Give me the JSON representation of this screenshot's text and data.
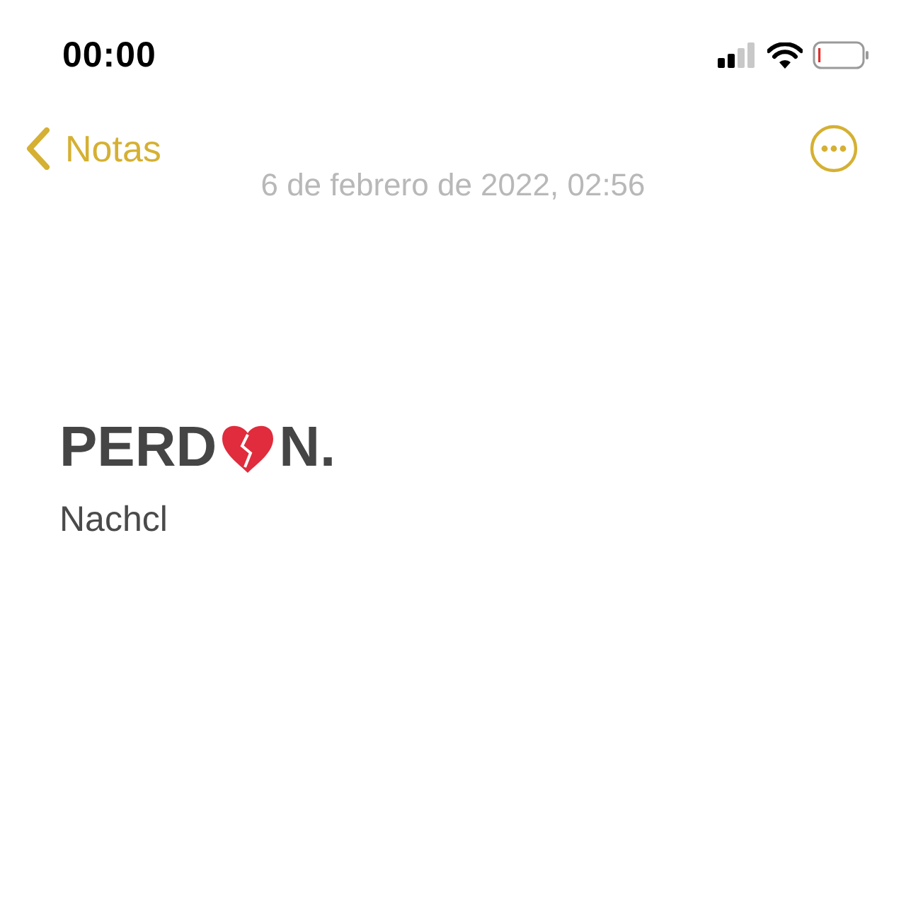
{
  "status_bar": {
    "time": "00:00"
  },
  "nav": {
    "back_label": "Notas"
  },
  "note": {
    "date": "6 de febrero de 2022, 02:56",
    "title_parts": [
      "PERD",
      "N."
    ],
    "body": "Nachcl"
  }
}
